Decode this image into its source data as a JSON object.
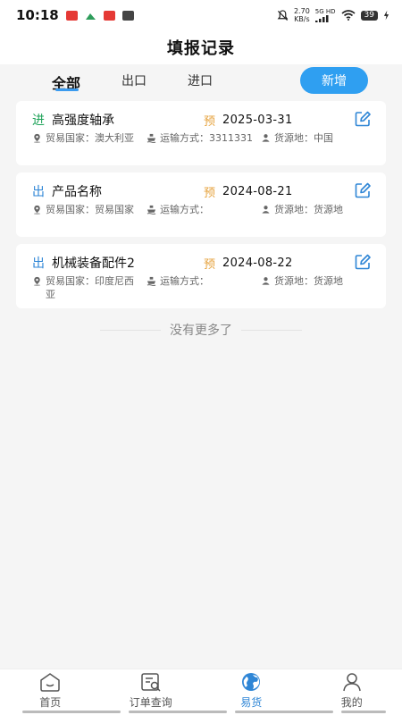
{
  "status_bar": {
    "time": "10:18",
    "speed_value": "2.70",
    "speed_unit": "KB/s",
    "network": "5G HD",
    "battery": "39",
    "icons": [
      "notification-icon",
      "mute-icon",
      "signal-icon",
      "wifi-icon",
      "battery-icon",
      "charging-icon"
    ]
  },
  "header": {
    "title": "填报记录"
  },
  "tabs": [
    {
      "label": "全部",
      "active": true
    },
    {
      "label": "出口",
      "active": false
    },
    {
      "label": "进口",
      "active": false
    }
  ],
  "actions": {
    "add_label": "新增"
  },
  "records": [
    {
      "type": "进",
      "title": "高强度轴承",
      "pre": "预",
      "date": "2025-03-31",
      "country_label": "贸易国家：澳大利亚",
      "transport_label": "运输方式：3311331",
      "origin_label": "货源地：中国"
    },
    {
      "type": "出",
      "title": "产品名称",
      "pre": "预",
      "date": "2024-08-21",
      "country_label": "贸易国家：贸易国家",
      "transport_label": "运输方式：",
      "origin_label": "货源地：货源地"
    },
    {
      "type": "出",
      "title": "机械装备配件2",
      "pre": "预",
      "date": "2024-08-22",
      "country_label": "贸易国家：印度尼西亚",
      "transport_label": "运输方式：",
      "origin_label": "货源地：货源地"
    }
  ],
  "list_end": {
    "text": "没有更多了"
  },
  "bottom_nav": [
    {
      "label": "首页",
      "icon": "home-icon",
      "active": false
    },
    {
      "label": "订单查询",
      "icon": "order-search-icon",
      "active": false
    },
    {
      "label": "易货",
      "icon": "globe-icon",
      "active": true
    },
    {
      "label": "我的",
      "icon": "profile-icon",
      "active": false
    }
  ],
  "colors": {
    "accent": "#2f9ff1",
    "import_tag": "#20a35a",
    "export_tag": "#2f86d6",
    "pre_tag": "#e6a23c",
    "background": "#f5f5f5"
  }
}
